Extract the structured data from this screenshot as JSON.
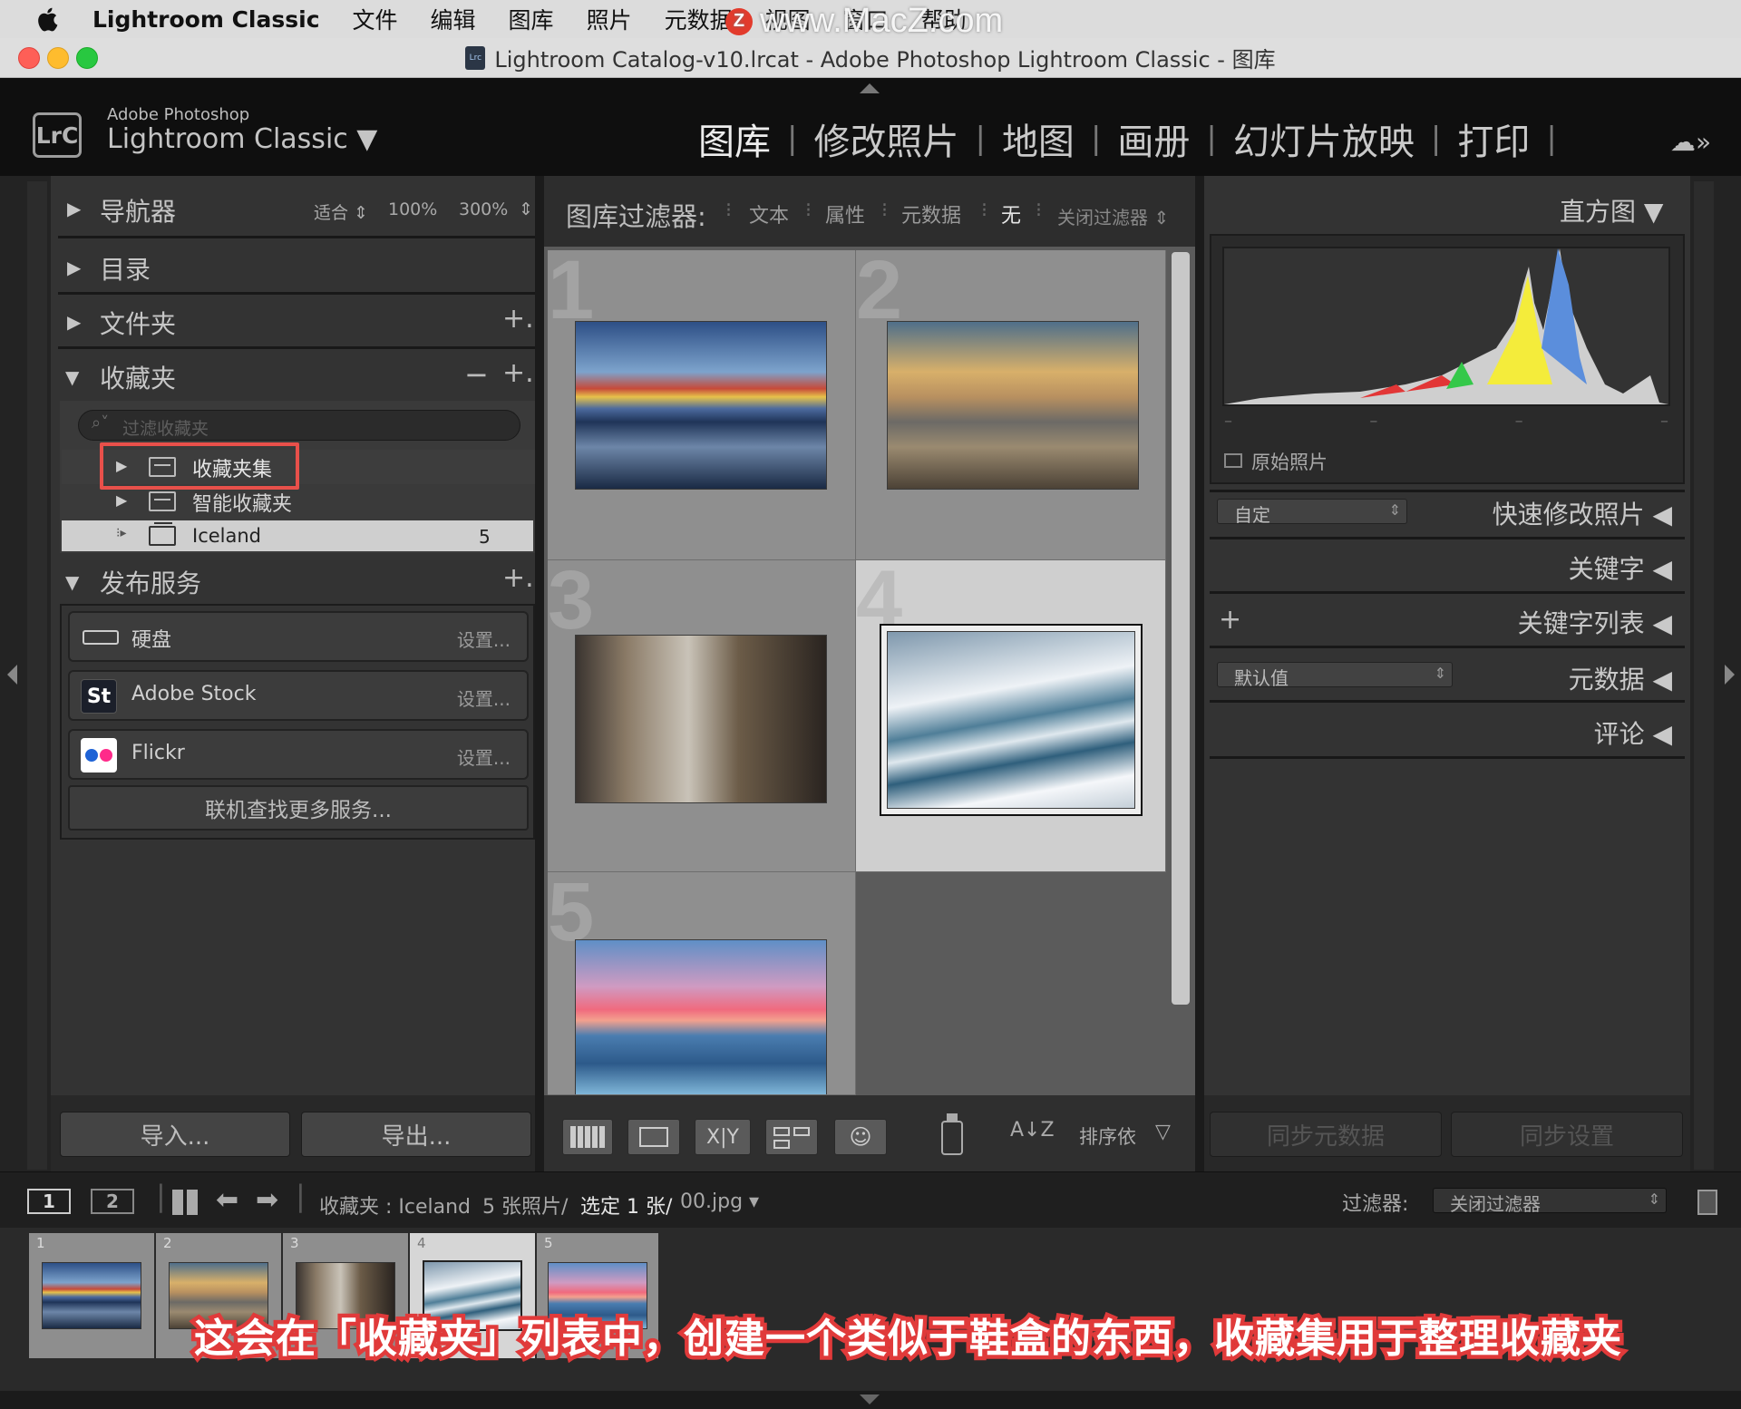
{
  "menubar": {
    "app_name": "Lightroom Classic",
    "menus": [
      "文件",
      "编辑",
      "图库",
      "照片",
      "元数据",
      "视图",
      "窗口",
      "帮助"
    ],
    "watermark": "www.MacZ.com",
    "watermark_logo": "Z"
  },
  "window": {
    "title": "Lightroom Catalog-v10.lrcat - Adobe Photoshop Lightroom Classic - 图库",
    "doc_icon": "Lrc"
  },
  "brand": {
    "logo": "LrC",
    "line1": "Adobe Photoshop",
    "line2": "Lightroom Classic ▼"
  },
  "modules": {
    "items": [
      "图库",
      "修改照片",
      "地图",
      "画册",
      "幻灯片放映",
      "打印"
    ],
    "active_index": 0,
    "cloud_icon": "☁»"
  },
  "left_panel": {
    "navigator": {
      "title": "导航器",
      "zoom": [
        "适合 ⇕",
        "100%",
        "300%",
        "⇕"
      ]
    },
    "catalog": {
      "title": "目录"
    },
    "folders": {
      "title": "文件夹",
      "add": "+."
    },
    "collections": {
      "title": "收藏夹",
      "minus": "−",
      "add": "+.",
      "filter_placeholder": "过滤收藏夹",
      "items": [
        {
          "label": "收藏夹集",
          "count": ""
        },
        {
          "label": "智能收藏夹",
          "count": ""
        },
        {
          "label": "Iceland",
          "count": "5"
        }
      ]
    },
    "publish": {
      "title": "发布服务",
      "add": "+.",
      "services": [
        {
          "name": "硬盘",
          "setup": "设置..."
        },
        {
          "name": "Adobe Stock",
          "setup": "设置..."
        },
        {
          "name": "Flickr",
          "setup": "设置..."
        }
      ],
      "more": "联机查找更多服务..."
    },
    "import_label": "导入...",
    "export_label": "导出..."
  },
  "filter_bar": {
    "title": "图库过滤器:",
    "options": [
      "文本",
      "属性",
      "元数据",
      "无"
    ],
    "close": "关闭过滤器 ⇕"
  },
  "grid": {
    "cells": [
      {
        "num": "1",
        "scene": "colorful houses reflection"
      },
      {
        "num": "2",
        "scene": "beach sunset"
      },
      {
        "num": "3",
        "scene": "city street taxis"
      },
      {
        "num": "4",
        "scene": "icy waterfall"
      },
      {
        "num": "5",
        "scene": "pink sunset over ice"
      }
    ],
    "selected_num": "4"
  },
  "toolbar": {
    "sort_label": "排序依",
    "sort_icon": "A↓Z"
  },
  "right_panel": {
    "histogram": {
      "title": "直方图 ▼",
      "original": "原始照片"
    },
    "quick_develop": {
      "title": "快速修改照片 ◀",
      "preset": "自定"
    },
    "keywording": {
      "title": "关键字 ◀"
    },
    "keyword_list": {
      "title": "关键字列表 ◀",
      "add": "+"
    },
    "metadata": {
      "title": "元数据 ◀",
      "preset": "默认值"
    },
    "comments": {
      "title": "评论 ◀"
    },
    "sync_metadata": "同步元数据",
    "sync_settings": "同步设置"
  },
  "filmstrip_bar": {
    "screen1": "1",
    "screen2": "2",
    "source": "收藏夹 : Iceland",
    "count": "5 张照片/",
    "selected": "选定 1 张/",
    "filename": "00.jpg ▾",
    "filter_label": "过滤器:",
    "filter_value": "关闭过滤器",
    "thumb_nums": [
      "1",
      "2",
      "3",
      "4",
      "5"
    ]
  },
  "caption": "这会在「收藏夹」列表中，创建一个类似于鞋盒的东西，收藏集用于整理收藏夹",
  "colors": {
    "panel": "#333333",
    "highlight_box": "#e8504a",
    "caption_stroke": "#e03a3a"
  }
}
